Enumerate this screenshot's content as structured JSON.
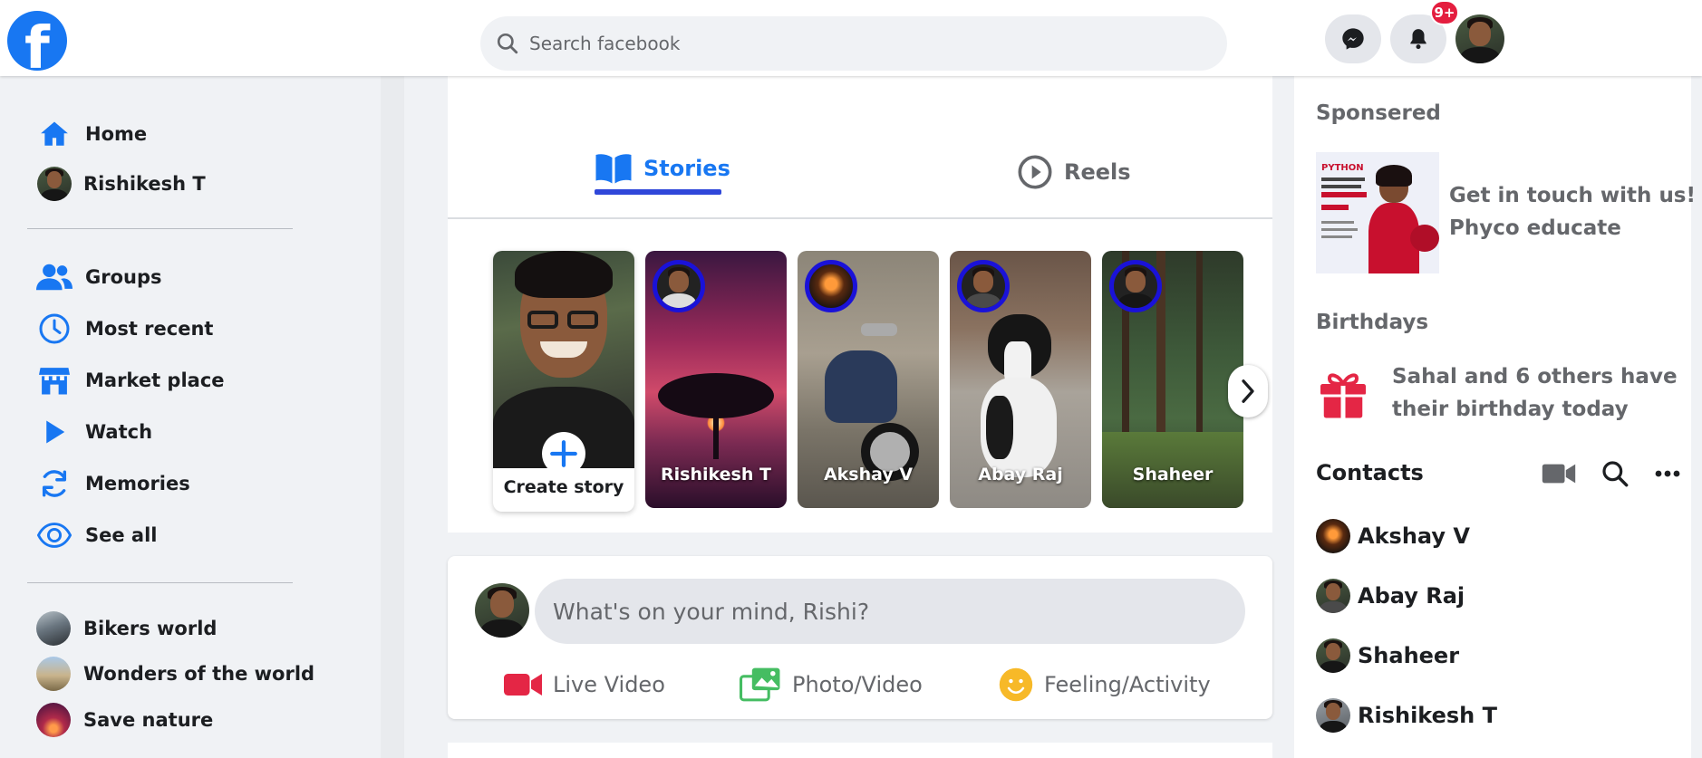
{
  "header": {
    "logo_letter": "f",
    "search_placeholder": "Search facebook",
    "notification_badge": "9+"
  },
  "sidebar": {
    "items": [
      {
        "label": "Home",
        "icon": "home-icon"
      },
      {
        "label": "Rishikesh T",
        "icon": "profile-avatar"
      }
    ],
    "menu": [
      {
        "label": "Groups",
        "icon": "groups-icon"
      },
      {
        "label": "Most recent",
        "icon": "clock-icon"
      },
      {
        "label": "Market place",
        "icon": "store-icon"
      },
      {
        "label": "Watch",
        "icon": "play-icon"
      },
      {
        "label": "Memories",
        "icon": "refresh-icon"
      },
      {
        "label": "See all",
        "icon": "eye-icon"
      }
    ],
    "groups": [
      {
        "label": "Bikers world"
      },
      {
        "label": "Wonders of the world"
      },
      {
        "label": "Save nature"
      }
    ]
  },
  "stories": {
    "tabs": [
      {
        "label": "Stories",
        "active": true
      },
      {
        "label": "Reels",
        "active": false
      }
    ],
    "create_label": "Create story",
    "items": [
      {
        "name": "Rishikesh T"
      },
      {
        "name": "Akshay V"
      },
      {
        "name": "Abay Raj"
      },
      {
        "name": "Shaheer"
      }
    ]
  },
  "composer": {
    "placeholder": "What's on your mind, Rishi?",
    "actions": [
      {
        "label": "Live Video",
        "icon": "video-camera-icon",
        "color": "#e42645"
      },
      {
        "label": "Photo/Video",
        "icon": "photo-gallery-icon",
        "color": "#45bd62"
      },
      {
        "label": "Feeling/Activity",
        "icon": "smiley-icon",
        "color": "#f7b928"
      }
    ]
  },
  "right": {
    "sponsored_title": "Sponsered",
    "ad": {
      "line1": "Get in touch with us!",
      "line2": "Phyco educate",
      "image_text": [
        "PYTHON"
      ]
    },
    "birthdays_title": "Birthdays",
    "birthday": {
      "line1": "Sahal and 6 others have",
      "line2": "their birthday today"
    },
    "contacts_title": "Contacts",
    "contacts": [
      {
        "name": "Akshay V"
      },
      {
        "name": "Abay Raj"
      },
      {
        "name": "Shaheer"
      },
      {
        "name": "Rishikesh T"
      }
    ]
  },
  "colors": {
    "brand": "#1877f2",
    "badge": "#e41e3f",
    "story_ring": "#1a12d8",
    "tab_underline": "#2f47d9"
  }
}
